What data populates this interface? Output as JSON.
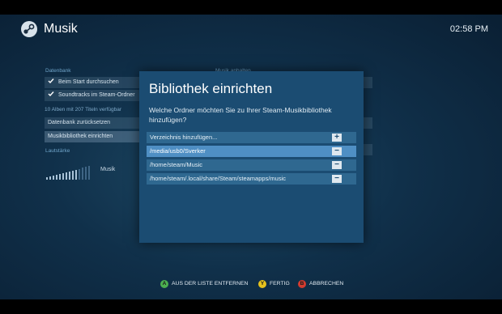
{
  "header": {
    "title": "Musik",
    "time": "02:58 PM"
  },
  "background": {
    "database_label": "Datenbank",
    "right_column_label": "Musik anhalten",
    "options": [
      {
        "label": "Beim Start durchsuchen",
        "checked": true
      },
      {
        "label": "Soundtracks im Steam-Ordner",
        "checked": true
      }
    ],
    "found_text": "10 Alben mit 207 Titeln verfügbar",
    "buttons": [
      "Datenbank zurücksetzen",
      "Musikbibliothek einrichten"
    ],
    "volume_label": "Lautstärke",
    "volume_caption": "Musik",
    "volume_level": 0.7
  },
  "dialog": {
    "title": "Bibliothek einrichten",
    "description": "Welche Ordner möchten Sie zu Ihrer Steam-Musikbibliothek hinzufügen?",
    "add_row": {
      "label": "Verzeichnis hinzufügen...",
      "button": "+"
    },
    "folders": [
      {
        "path": "/media/usb0/Sverker",
        "selected": true
      },
      {
        "path": "/home/steam/Music",
        "selected": false
      },
      {
        "path": "/home/steam/.local/share/Steam/steamapps/music",
        "selected": false
      }
    ],
    "remove_glyph": "−"
  },
  "footer": {
    "hints": [
      {
        "glyph": "A",
        "color": "#4caf50",
        "label": "AUS DER LISTE ENTFERNEN"
      },
      {
        "glyph": "Y",
        "color": "#e6c21d",
        "label": "FERTIG"
      },
      {
        "glyph": "B",
        "color": "#d23b2f",
        "label": "ABBRECHEN"
      }
    ]
  },
  "colors": {
    "dialog_bg": "#1b4c72",
    "selected_row": "#4f8fc4",
    "row": "#2f6890"
  }
}
